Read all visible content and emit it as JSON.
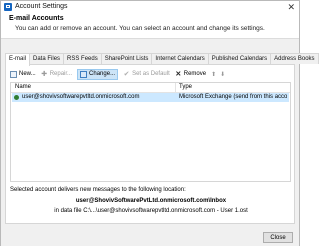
{
  "window": {
    "title": "Account Settings",
    "close_glyph": "✕"
  },
  "header": {
    "title": "E-mail Accounts",
    "subtitle": "You can add or remove an account. You can select an account and change its settings."
  },
  "tabs": [
    {
      "label": "E-mail",
      "active": true
    },
    {
      "label": "Data Files"
    },
    {
      "label": "RSS Feeds"
    },
    {
      "label": "SharePoint Lists"
    },
    {
      "label": "Internet Calendars"
    },
    {
      "label": "Published Calendars"
    },
    {
      "label": "Address Books"
    }
  ],
  "toolbar": {
    "new": "New...",
    "repair": "Repair...",
    "change": "Change...",
    "set_default": "Set as Default",
    "remove": "Remove",
    "up": "⬆",
    "down": "⬇"
  },
  "accounts_table": {
    "columns": [
      "Name",
      "Type"
    ],
    "rows": [
      {
        "name": "user@shoviv⁠softwarepvtltd.onmicrosoft.com",
        "type": "Microsoft Exchange (send from this account by def..."
      }
    ]
  },
  "delivery": {
    "intro": "Selected account delivers new messages to the following location:",
    "location": "user@ShovivSoftwarePvtLtd.onmicrosoft.com\\Inbox",
    "data_file": "in data file C:\\...\\user@shovivsoftwarepvtltd.onmicrosoft.com - User 1.ost"
  },
  "footer": {
    "close": "Close"
  },
  "colors": {
    "selection": "#cce8ff",
    "accent": "#1565c0"
  }
}
